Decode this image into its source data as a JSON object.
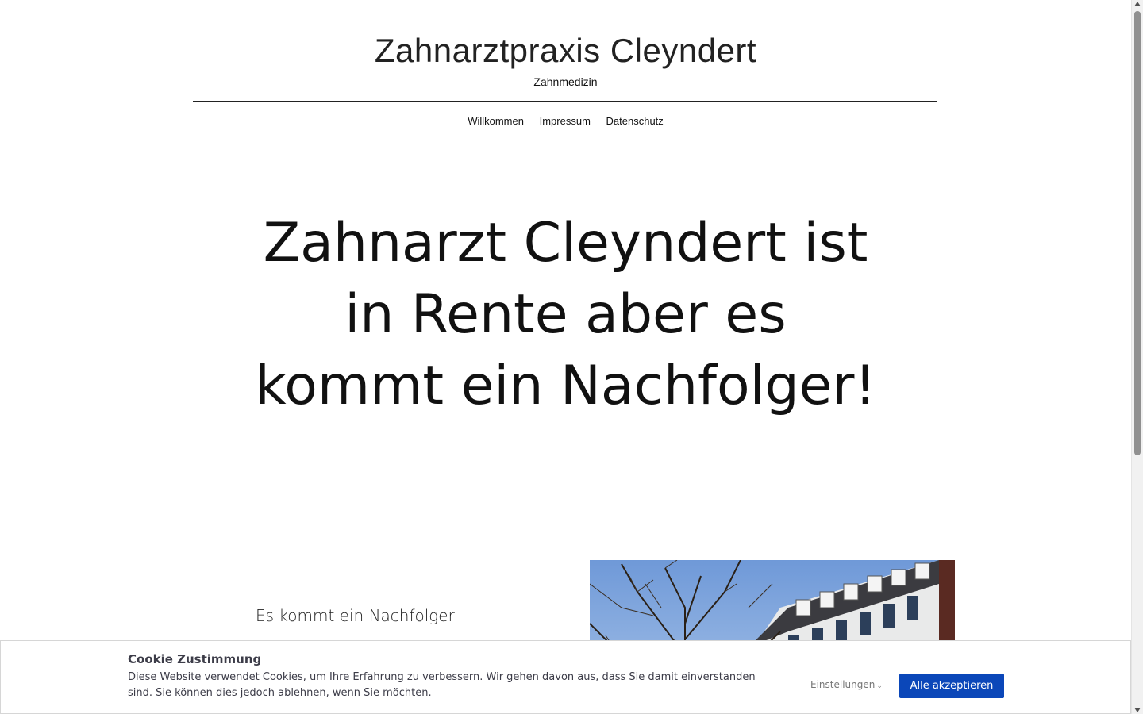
{
  "header": {
    "site_title": "Zahnarztpraxis Cleyndert",
    "site_subtitle": "Zahnmedizin"
  },
  "nav": {
    "items": [
      {
        "label": "Willkommen"
      },
      {
        "label": "Impressum"
      },
      {
        "label": "Datenschutz"
      }
    ]
  },
  "hero": {
    "line1": "Zahnarzt Cleyndert ist",
    "line2": "in Rente aber es",
    "line3": "kommt ein Nachfolger!"
  },
  "content": {
    "subheading": "Es kommt ein Nachfolger"
  },
  "cookie_banner": {
    "title": "Cookie Zustimmung",
    "text": "Diese Website verwendet Cookies, um Ihre Erfahrung zu verbessern. Wir gehen davon aus, dass Sie damit einverstanden sind. Sie können dies jedoch ablehnen, wenn Sie möchten.",
    "settings_label": "Einstellungen",
    "accept_label": "Alle akzeptieren",
    "accept_color": "#0b47b9"
  },
  "icons": {
    "settings_chevron": "chevron-down-icon",
    "scroll_up": "scroll-up-arrow-icon",
    "scroll_down": "scroll-down-arrow-icon"
  }
}
